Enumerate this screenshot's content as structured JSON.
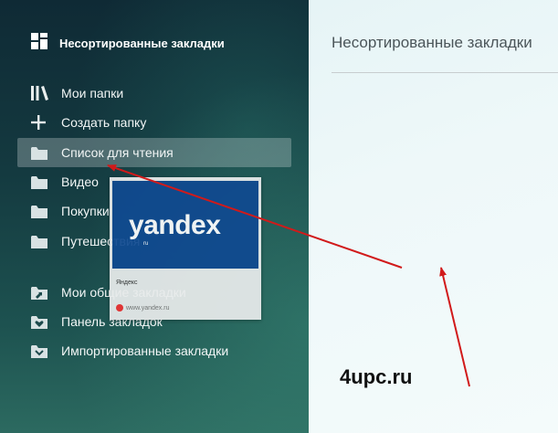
{
  "sidebar": {
    "header": {
      "title": "Несортированные закладки",
      "icon": "bookmarks-grid-icon"
    },
    "items": [
      {
        "label": "Мои папки",
        "icon": "library-icon",
        "active": false
      },
      {
        "label": "Создать папку",
        "icon": "plus-icon",
        "active": false
      },
      {
        "label": "Список для чтения",
        "icon": "folder-icon",
        "active": true
      },
      {
        "label": "Видео",
        "icon": "folder-icon",
        "active": false
      },
      {
        "label": "Покупки",
        "icon": "folder-icon",
        "active": false
      },
      {
        "label": "Путешествия",
        "icon": "folder-icon",
        "active": false
      },
      {
        "label": "Мои общие закладки",
        "icon": "shared-folder-icon",
        "active": false
      },
      {
        "label": "Панель закладок",
        "icon": "heart-folder-icon",
        "active": false
      },
      {
        "label": "Импортированные закладки",
        "icon": "import-folder-icon",
        "active": false
      }
    ]
  },
  "main": {
    "title": "Несортированные закладки"
  },
  "drag_card": {
    "logo": "yandex",
    "tld": "ru",
    "title": "Яндекс",
    "url": "www.yandex.ru"
  },
  "watermark": "4upc.ru",
  "colors": {
    "arrow": "#d11a1a",
    "thumb_bg": "#104a91",
    "active_item_bg": "rgba(255,255,255,0.25)"
  }
}
